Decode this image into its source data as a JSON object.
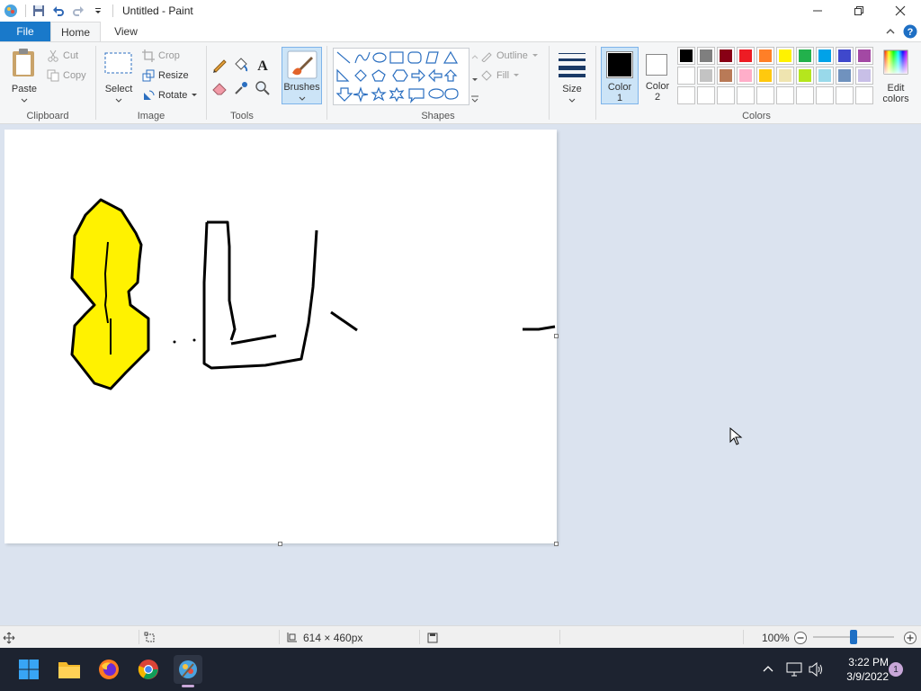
{
  "window": {
    "title": "Untitled - Paint",
    "qat_icons": [
      "paint-app-icon",
      "save-icon",
      "undo-icon",
      "redo-icon",
      "customize-qat-icon"
    ],
    "controls": [
      "minimize-icon",
      "maximize-icon",
      "close-icon"
    ]
  },
  "tabs": {
    "file": "File",
    "home": "Home",
    "view": "View"
  },
  "ribbon": {
    "clipboard": {
      "label": "Clipboard",
      "paste": "Paste",
      "cut": "Cut",
      "copy": "Copy"
    },
    "image": {
      "label": "Image",
      "select": "Select",
      "crop": "Crop",
      "resize": "Resize",
      "rotate": "Rotate"
    },
    "tools": {
      "label": "Tools"
    },
    "brushes": {
      "label": "Brushes"
    },
    "shapes": {
      "label": "Shapes",
      "outline": "Outline",
      "fill": "Fill"
    },
    "size": {
      "label": "Size"
    },
    "colors": {
      "label": "Colors",
      "color1_line1": "Color",
      "color1_line2": "1",
      "color2_line1": "Color",
      "color2_line2": "2",
      "edit_line1": "Edit",
      "edit_line2": "colors",
      "color1_value": "#000000",
      "color2_value": "#ffffff",
      "palette_row1": [
        "#000000",
        "#7f7f7f",
        "#880015",
        "#ed1c24",
        "#ff7f27",
        "#fff200",
        "#22b14c",
        "#00a2e8",
        "#3f48cc",
        "#a349a4"
      ],
      "palette_row2": [
        "#ffffff",
        "#c3c3c3",
        "#b97a57",
        "#ffaec9",
        "#ffc90e",
        "#efe4b0",
        "#b5e61d",
        "#99d9ea",
        "#7092be",
        "#c8bfe7"
      ],
      "palette_row3": [
        "#ffffff",
        "#ffffff",
        "#ffffff",
        "#ffffff",
        "#ffffff",
        "#ffffff",
        "#ffffff",
        "#ffffff",
        "#ffffff",
        "#ffffff"
      ]
    }
  },
  "status": {
    "dimensions": "614 × 460px",
    "zoom": "100%",
    "zoom_level": 0.5
  },
  "taskbar": {
    "time": "3:22 PM",
    "date": "3/9/2022",
    "notifications": "1"
  }
}
